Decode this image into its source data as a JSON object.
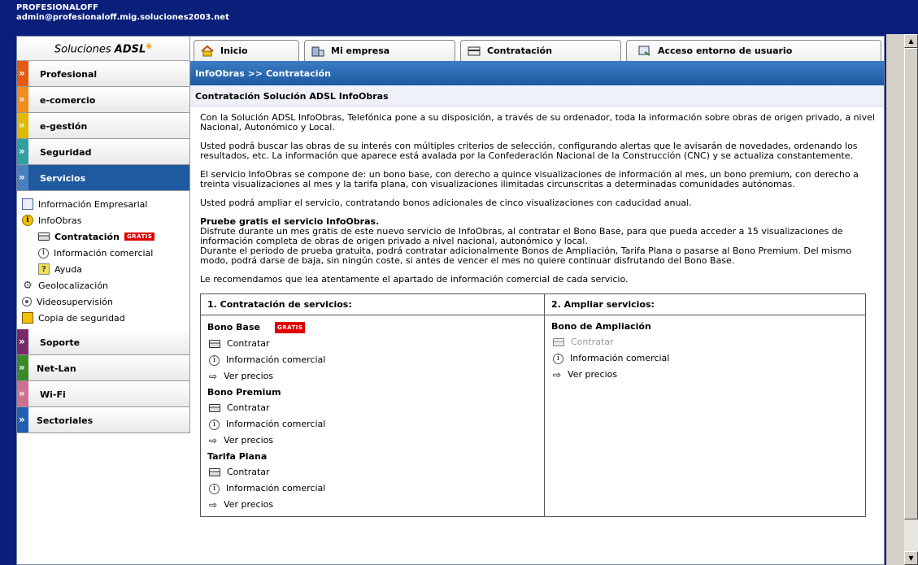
{
  "header": {
    "title": "PROFESIONALOFF",
    "user": "admin@profesionaloff.mig.soluciones2003.net"
  },
  "brand": {
    "label": "Soluciones ",
    "strong": "ADSL"
  },
  "categories": [
    {
      "label": "Profesional",
      "color": "#e85a10"
    },
    {
      "label": "e-comercio",
      "color": "#f28c1e"
    },
    {
      "label": "e-gestión",
      "color": "#e0b800"
    },
    {
      "label": "Seguridad",
      "color": "#2fa0a0"
    },
    {
      "label": "Servicios",
      "color": "#1f5aa0"
    },
    {
      "label": "Soporte",
      "color": "#7a2a6a"
    },
    {
      "label": "Net-Lan",
      "color": "#3a8a2a"
    },
    {
      "label": "Wi-Fi",
      "color": "#d07090"
    },
    {
      "label": "Sectoriales",
      "color": "#2060b0"
    }
  ],
  "subnav": {
    "info_empresarial": "Información Empresarial",
    "infoobras": "InfoObras",
    "contratacion": "Contratación",
    "gratis": "GRATIS",
    "info_comercial": "Información comercial",
    "ayuda": "Ayuda",
    "geolocalizacion": "Geolocalización",
    "videosupervision": "Videosupervisión",
    "copia": "Copia de seguridad"
  },
  "tabs": {
    "inicio": "Inicio",
    "empresa": "Mi empresa",
    "contratacion": "Contratación",
    "acceso": "Acceso entorno de usuario"
  },
  "breadcrumb": "InfoObras >> Contratación",
  "section_title": "Contratación Solución ADSL InfoObras",
  "paragraphs": {
    "p1": "Con la Solución ADSL InfoObras, Telefónica pone a su disposición, a través de su ordenador, toda la información sobre obras de origen privado, a nivel Nacional, Autonómico y Local.",
    "p2": "Usted podrá buscar las obras de su interés con múltiples criterios de selección, configurando alertas que le avisarán de novedades, ordenando los resultados, etc. La información que aparece está avalada por la Confederación Nacional de la Construcción (CNC) y se actualiza constantemente.",
    "p3": "El servicio InfoObras se compone de: un bono base, con derecho a quince visualizaciones de información al mes, un bono premium, con derecho a treinta visualizaciones al mes y la tarifa plana, con visualizaciones ilimitadas circunscritas a determinadas comunidades autónomas.",
    "p4": "Usted podrá ampliar el servicio, contratando bonos adicionales de cinco visualizaciones con caducidad anual.",
    "p5_title": "Pruebe gratis el servicio InfoObras.",
    "p5a": "Disfrute durante un mes gratis de este nuevo servicio de InfoObras, al contratar el Bono Base, para que pueda acceder a 15 visualizaciones de información completa de obras de origen privado a nivel nacional, autonómico y local.",
    "p5b": "Durante el periodo de prueba gratuita, podrá contratar adicionalmente Bonos de Ampliación, Tarifa Plana o pasarse al Bono Premium. Del mismo modo, podrá darse de baja, sin ningún coste, si antes de vencer el mes no quiere continuar disfrutando del Bono Base.",
    "p6": "Le recomendamos que lea atentamente el apartado de información comercial de cada servicio."
  },
  "box1": {
    "title": "1. Contratación de servicios:",
    "services": [
      {
        "name": "Bono Base",
        "badge": "GRATIS",
        "contratar": "Contratar",
        "info": "Información comercial",
        "precios": "Ver precios"
      },
      {
        "name": "Bono Premium",
        "contratar": "Contratar",
        "info": "Información comercial",
        "precios": "Ver precios"
      },
      {
        "name": "Tarifa Plana",
        "contratar": "Contratar",
        "info": "Información comercial",
        "precios": "Ver precios"
      }
    ]
  },
  "box2": {
    "title": "2. Ampliar servicios:",
    "service": {
      "name": "Bono de Ampliación",
      "contratar": "Contratar",
      "info": "Información comercial",
      "precios": "Ver precios"
    }
  }
}
